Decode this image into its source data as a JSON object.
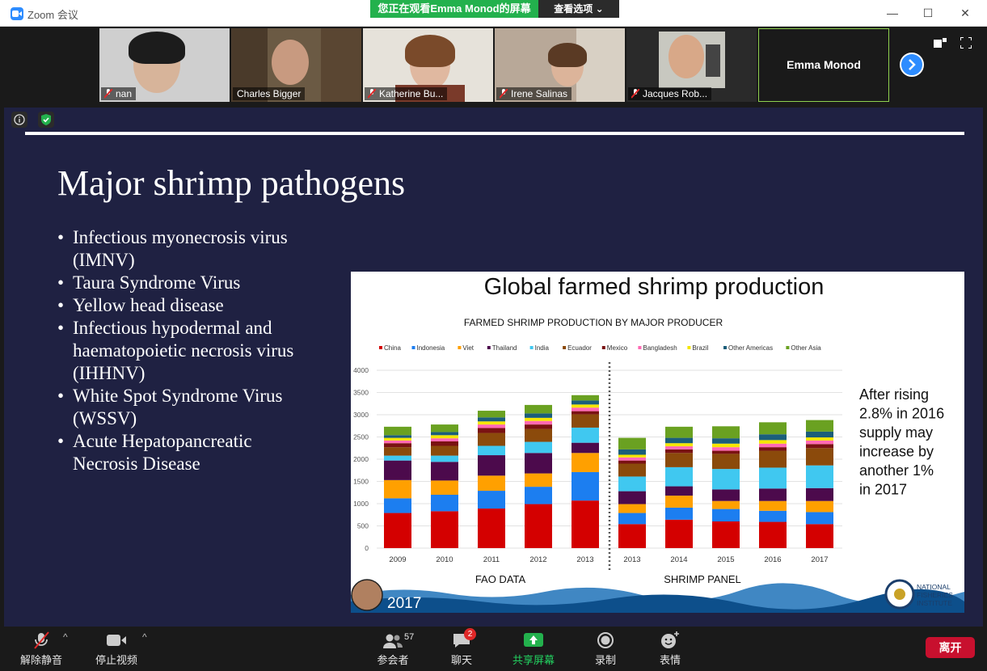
{
  "window": {
    "title": "Zoom 会议",
    "share_banner": "您正在观看Emma  Monod的屏幕",
    "view_options": "查看选项",
    "minimize": "—",
    "maximize": "☐",
    "close": "✕"
  },
  "participants": [
    {
      "name": "nan"
    },
    {
      "name": "Charles Bigger"
    },
    {
      "name": "Katherine Bu..."
    },
    {
      "name": "Irene Salinas"
    },
    {
      "name": "Jacques Rob..."
    }
  ],
  "active_speaker": "Emma Monod",
  "slide": {
    "title": "Major shrimp pathogens",
    "bullets": [
      "Infectious myonecrosis virus (IMNV)",
      "Taura Syndrome Virus",
      "Yellow head disease",
      "Infectious hypodermal and haematopoietic necrosis virus (IHHNV)",
      "White Spot Syndrome Virus (WSSV)",
      "Acute Hepatopancreatic Necrosis Disease"
    ]
  },
  "chart_data": {
    "type": "bar",
    "stacked": true,
    "title": "Global farmed shrimp production",
    "subtitle": "FARMED SHRIMP PRODUCTION BY MAJOR PRODUCER",
    "categories": [
      "2009",
      "2010",
      "2011",
      "2012",
      "2013",
      "2013",
      "2014",
      "2015",
      "2016",
      "2017"
    ],
    "group_labels": [
      "FAO DATA",
      "SHRIMP PANEL"
    ],
    "ylim": [
      0,
      4000
    ],
    "yticks": [
      0,
      500,
      1000,
      1500,
      2000,
      2500,
      3000,
      3500,
      4000
    ],
    "grid": true,
    "legend_position": "top",
    "annotation": "After rising 2.8% in 2016 supply may increase by another 1% in 2017",
    "footer_year": "2017",
    "footer_logo_text": "NATIONAL FISHERIES INSTITUTE",
    "series": [
      {
        "name": "China",
        "color": "#d40000",
        "values": [
          790,
          830,
          890,
          990,
          1070,
          540,
          640,
          600,
          590,
          540
        ]
      },
      {
        "name": "Indonesia",
        "color": "#1c7ef0",
        "values": [
          330,
          370,
          400,
          390,
          640,
          250,
          270,
          280,
          250,
          270
        ]
      },
      {
        "name": "Viet",
        "color": "#ffa000",
        "values": [
          410,
          320,
          340,
          300,
          430,
          200,
          270,
          180,
          220,
          250
        ]
      },
      {
        "name": "Thailand",
        "color": "#4c0a4c",
        "values": [
          440,
          420,
          460,
          460,
          230,
          290,
          210,
          260,
          280,
          290
        ]
      },
      {
        "name": "India",
        "color": "#40c8f0",
        "values": [
          110,
          140,
          210,
          250,
          340,
          330,
          430,
          460,
          470,
          510
        ]
      },
      {
        "name": "Ecuador",
        "color": "#8b4a0b",
        "values": [
          190,
          220,
          290,
          290,
          300,
          290,
          320,
          340,
          380,
          390
        ]
      },
      {
        "name": "Mexico",
        "color": "#7a1212",
        "values": [
          90,
          100,
          110,
          100,
          70,
          70,
          80,
          70,
          80,
          90
        ]
      },
      {
        "name": "Bangladesh",
        "color": "#ff69b4",
        "values": [
          60,
          70,
          80,
          80,
          80,
          70,
          70,
          80,
          80,
          80
        ]
      },
      {
        "name": "Brazil",
        "color": "#f5e600",
        "values": [
          60,
          70,
          70,
          70,
          70,
          60,
          70,
          80,
          80,
          70
        ]
      },
      {
        "name": "Other Americas",
        "color": "#1b5e7a",
        "values": [
          60,
          70,
          90,
          100,
          90,
          120,
          120,
          120,
          130,
          130
        ]
      },
      {
        "name": "Other Asia",
        "color": "#6aa121",
        "values": [
          190,
          170,
          150,
          190,
          120,
          260,
          250,
          270,
          270,
          260
        ]
      }
    ]
  },
  "toolbar": {
    "unmute": "解除静音",
    "stop_video": "停止视频",
    "participants": "参会者",
    "participants_count": "57",
    "chat": "聊天",
    "chat_badge": "2",
    "share_screen": "共享屏幕",
    "record": "录制",
    "reactions": "表情",
    "leave": "离开"
  },
  "colors": {
    "zoom_blue": "#2d8cff",
    "share_green": "#23b14d",
    "slide_bg": "#1f2142",
    "leave_red": "#c8102e",
    "active_border": "#8fd14f"
  }
}
